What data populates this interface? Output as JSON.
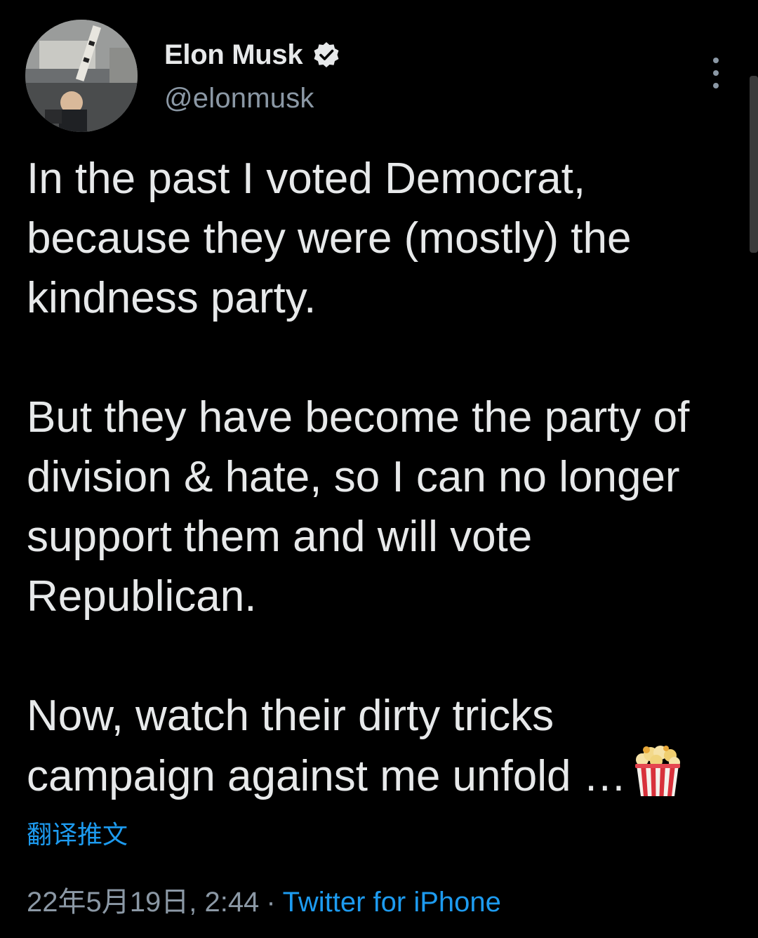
{
  "user": {
    "display_name": "Elon Musk",
    "handle": "@elonmusk",
    "verified": true,
    "avatar_icon": "user-avatar-photo",
    "verified_icon": "verified-badge-icon"
  },
  "menu": {
    "icon": "more-vertical-icon"
  },
  "tweet": {
    "paragraphs": [
      "In the past I voted Democrat, because they were (mostly) the kindness party.",
      "But they have become the party of division & hate, so I can no longer support them and will vote Republican.",
      "Now, watch their dirty tricks campaign against me unfold …"
    ],
    "trailing_emoji_icon": "popcorn-icon"
  },
  "translate_label": "翻译推文",
  "meta": {
    "timestamp": "22年5月19日, 2:44",
    "separator": "·",
    "source": "Twitter for iPhone"
  },
  "colors": {
    "background": "#000000",
    "text_primary": "#e7e9ea",
    "text_secondary": "#8b98a5",
    "accent": "#1d9bf0"
  }
}
